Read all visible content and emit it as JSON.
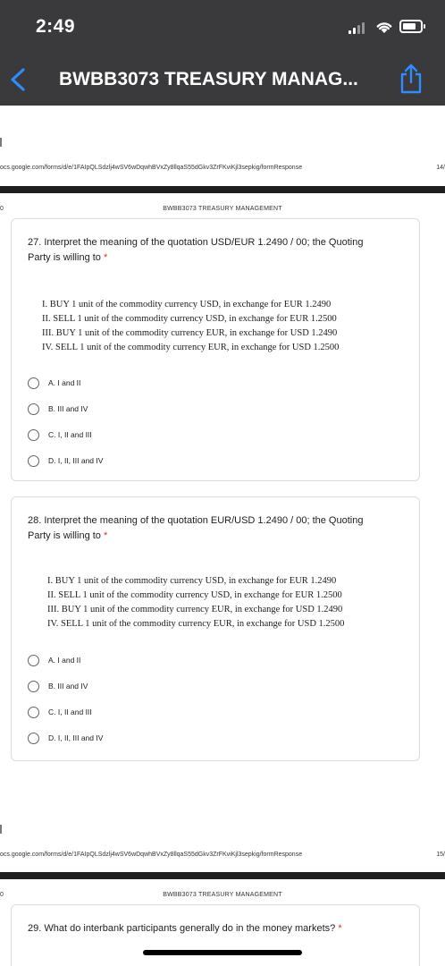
{
  "status_bar": {
    "time": "2:49"
  },
  "nav": {
    "title": "BWBB3073 TREASURY MANAG...",
    "back_icon": "chevron-left-icon",
    "share_icon": "share-icon",
    "accent": "#2f8cff"
  },
  "page1": {
    "url": "ocs.google.com/forms/d/e/1FAIpQLSdzlj4wSV6wDqwhBVxZy8llqaS55dGkv3ZrFKviKjl3sepkig/formResponse",
    "page_num": "14/",
    "zero": "0",
    "header": "BWBB3073 TREASURY MANAGEMENT"
  },
  "page2": {
    "url": "ocs.google.com/forms/d/e/1FAIpQLSdzlj4wSV6wDqwhBVxZy8llqaS55dGkv3ZrFKviKjl3sepkig/formResponse",
    "page_num": "15/",
    "zero": "0",
    "header": "BWBB3073 TREASURY MANAGEMENT"
  },
  "q27": {
    "title_line1": "27. Interpret the meaning of the quotation USD/EUR 1.2490 / 00; the Quoting",
    "title_line2": "Party is willing to",
    "required": "*",
    "statements": [
      "I.  BUY 1 unit of the commodity currency USD, in exchange for EUR 1.2490",
      "II.  SELL 1 unit of the commodity currency USD, in exchange for EUR 1.2500",
      "III. BUY 1 unit of the commodity currency EUR, in exchange for USD 1.2490",
      "IV. SELL 1 unit of the commodity currency EUR, in exchange for USD 1.2500"
    ],
    "options": [
      "A. I and II",
      "B. III and IV",
      "C. I, II and III",
      "D. I, II, III and IV"
    ]
  },
  "q28": {
    "title_line1": "28. Interpret the meaning of the quotation EUR/USD 1.2490 / 00; the Quoting",
    "title_line2": "Party is willing to",
    "required": "*",
    "statements": [
      "I.  BUY 1 unit of the commodity currency USD, in exchange for EUR 1.2490",
      "II.  SELL 1 unit of the commodity currency USD, in exchange for EUR 1.2500",
      "III. BUY 1 unit of the commodity currency EUR, in exchange for USD 1.2490",
      "IV. SELL 1 unit of the commodity currency EUR, in exchange for USD 1.2500"
    ],
    "options": [
      "A. I and II",
      "B. III and IV",
      "C. I, II and III",
      "D. I, II, III and IV"
    ]
  },
  "q29": {
    "title": "29. What do interbank participants generally do in the money markets?",
    "required": "*"
  }
}
